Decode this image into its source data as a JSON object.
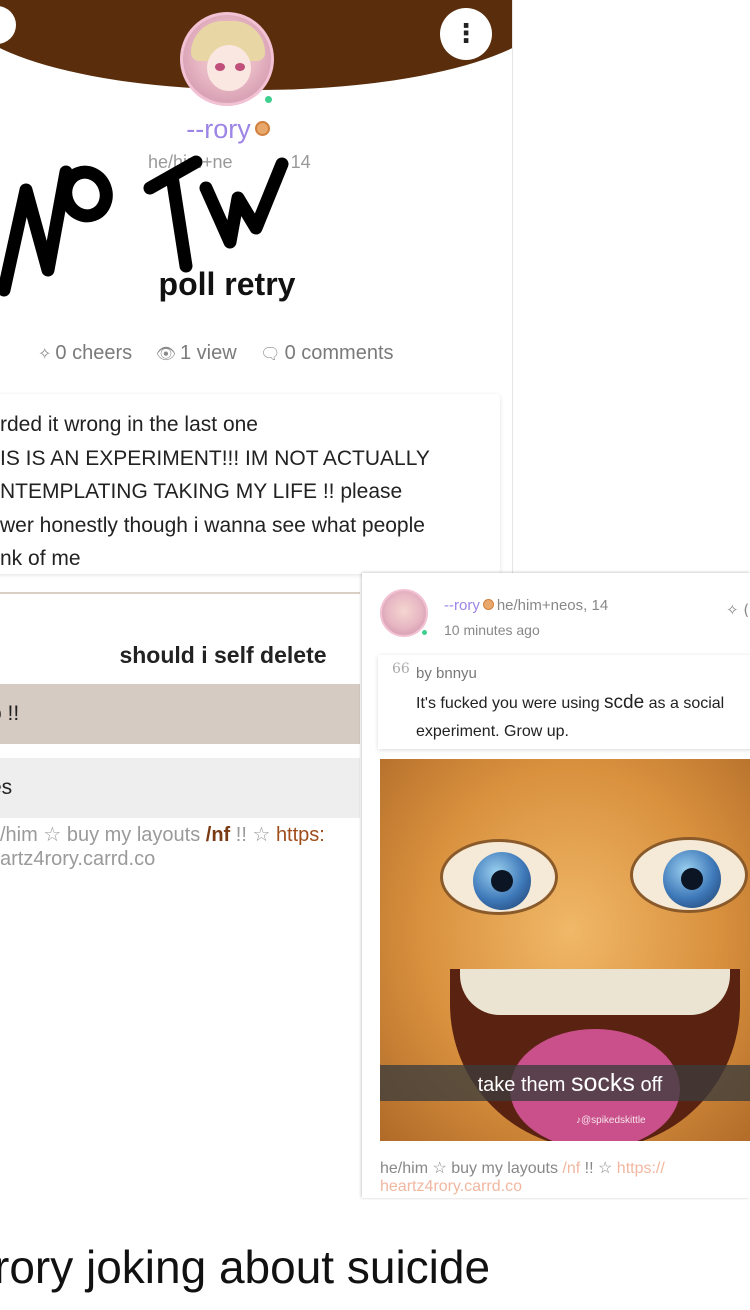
{
  "post": {
    "username": "--rory",
    "pronouns": "he/him+ne",
    "pronouns_age": "14",
    "overlay_text": "No TW",
    "title": "poll retry",
    "stats": {
      "cheers": "0 cheers",
      "views": "1 view",
      "comments": "0 comments"
    },
    "body_lines": [
      "rded it wrong in the last one",
      "IS IS AN EXPERIMENT!!! IM NOT ACTUALLY",
      "NTEMPLATING TAKING MY LIFE !! please",
      "wer honestly though i wanna see what people",
      "nk of me"
    ],
    "poll_question": "should i self delete",
    "poll_options": [
      "o !!",
      "es"
    ],
    "bio_prefix": "/him ☆ buy my layouts ",
    "bio_nf": "/nf",
    "bio_mid": " !! ☆ ",
    "bio_link": "https:",
    "bio_line2": "artz4rory.carrd.co",
    "icons": {
      "back": "arrow-left-icon",
      "more": "more-vertical-icon",
      "cheer": "sparkle-icon",
      "view": "eye-icon",
      "comment": "comment-icon"
    },
    "colors": {
      "header": "#5a2e0c",
      "username": "#9d85e6",
      "online": "#3fcf8e",
      "poll_selected": "#d6cbc2",
      "poll_other": "#eeeeee"
    }
  },
  "comment": {
    "username": "--rory",
    "pronouns": "he/him+neos, 14",
    "time": "10 minutes ago",
    "cheer_glyph": "✧ (",
    "quote_mark": "66",
    "quote_by": "by bnnyu",
    "quote_text_1": "It's fucked you were using ",
    "quote_text_scde": "scde",
    "quote_text_2": " as a social experiment. Grow up.",
    "meme_caption_1": "take them ",
    "meme_caption_big": "socks",
    "meme_caption_2": " off",
    "meme_watermark": "♪@spikedskittle",
    "bio_prefix": "he/him ☆ buy my layouts ",
    "bio_nf": "/nf",
    "bio_mid": " !! ☆ ",
    "bio_link": "https://",
    "bio_line2": "heartz4rory.carrd.co"
  },
  "caption": "rory joking about suicide"
}
